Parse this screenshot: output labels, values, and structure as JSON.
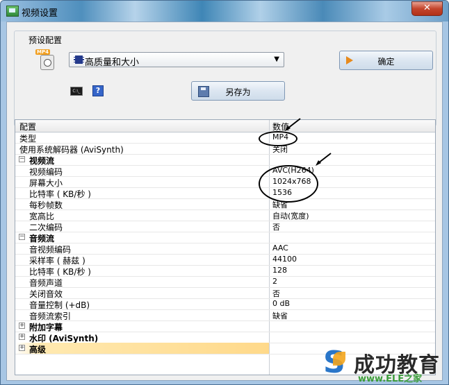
{
  "window": {
    "title": "视频设置",
    "close_glyph": "✕"
  },
  "preset_group": {
    "label": "预设配置",
    "mp4_badge": "MP4",
    "preset_value": "高质量和大小",
    "dropdown_glyph": "▼",
    "cmd_label": "C:\\_",
    "help_glyph": "?",
    "ok_label": "确定",
    "save_as_label": "另存为"
  },
  "grid": {
    "headers": {
      "name": "配置",
      "value": "数值"
    },
    "rows": [
      {
        "name": "类型",
        "value": "MP4"
      },
      {
        "name": "使用系统解码器 (AviSynth)",
        "value": "关闭"
      },
      {
        "name": "视频流",
        "category": true,
        "expander": "−"
      },
      {
        "name": "视频编码",
        "value": "AVC(H264)"
      },
      {
        "name": "屏幕大小",
        "value": "1024x768"
      },
      {
        "name": "比特率 ( KB/秒 )",
        "value": "1536"
      },
      {
        "name": "每秒帧数",
        "value": "缺省"
      },
      {
        "name": "宽高比",
        "value": "自动(宽度)"
      },
      {
        "name": "二次编码",
        "value": "否"
      },
      {
        "name": "音频流",
        "category": true,
        "expander": "−"
      },
      {
        "name": "音视频编码",
        "value": "AAC"
      },
      {
        "name": "采样率 ( 赫兹 )",
        "value": "44100"
      },
      {
        "name": "比特率 ( KB/秒 )",
        "value": "128"
      },
      {
        "name": "音频声道",
        "value": "2"
      },
      {
        "name": "关闭音效",
        "value": "否"
      },
      {
        "name": "音量控制 (+dB)",
        "value": "0 dB"
      },
      {
        "name": "音频流索引",
        "value": "缺省"
      },
      {
        "name": "附加字幕",
        "category": true,
        "expander": "+"
      },
      {
        "name": "水印 (AviSynth)",
        "category": true,
        "expander": "+"
      },
      {
        "name": "高级",
        "category": true,
        "expander": "+"
      }
    ]
  },
  "watermark": {
    "main": "成功教育",
    "sub": "www.ELE之家"
  },
  "colors": {
    "accent": "#2a76c9",
    "highlight": "#ffd98a",
    "ok_arrow": "#e78a1c"
  }
}
